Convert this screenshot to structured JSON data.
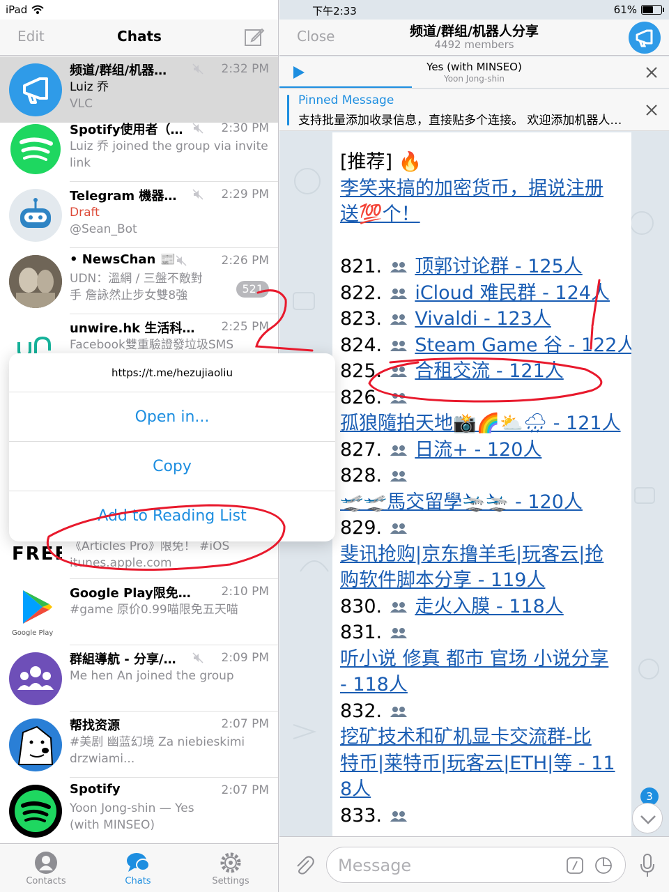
{
  "status_bar": {
    "device": "iPad",
    "time": "下午2:33",
    "battery": "61%",
    "battery_level": 0.61
  },
  "left_nav": {
    "edit_label": "Edit",
    "title": "Chats"
  },
  "chats": [
    {
      "name": "频道/群组/机器…",
      "time": "2:32 PM",
      "line1": "Luiz 乔",
      "line2": "VLC"
    },
    {
      "name": "Spotify使用者（…",
      "time": "2:30 PM",
      "line1": "Luiz 乔 joined the group via invite",
      "line2": "link"
    },
    {
      "name": "Telegram 機器…",
      "time": "2:29 PM",
      "line1": "Draft",
      "line2": "@Sean_Bot"
    },
    {
      "name": "• NewsChan 📰",
      "time": "2:26 PM",
      "line1": "UDN：溫網 / 三盤不敵對",
      "line2": "手 詹詠然止步女雙8強",
      "badge": "521"
    },
    {
      "name": "unwire.hk 生活科…",
      "time": "2:25 PM",
      "line1": "Facebook雙重驗證發垃圾SMS",
      "line2": ""
    },
    {
      "name": "",
      "time": "",
      "line1": "《Articles Pro》限免！ #iOS",
      "line2": "itunes.apple.com"
    },
    {
      "name": "Google Play限免…",
      "time": "2:10 PM",
      "line1": "#game 原价0.99喵限免五天喵",
      "line2": ""
    },
    {
      "name": "群組導航 - 分享/…",
      "time": "2:09 PM",
      "line1": "Me hen An joined the group",
      "line2": ""
    },
    {
      "name": "帮找资源",
      "time": "2:07 PM",
      "line1": "#美剧 幽蓝幻境 Za niebieskimi",
      "line2": "drzwiami..."
    },
    {
      "name": "Spotify",
      "time": "2:07 PM",
      "line1": "Yoon Jong-shin — Yes",
      "line2": "(with MINSEO)"
    }
  ],
  "avatar_text": {
    "freebie": "FREE",
    "google_play": "Google Play"
  },
  "tabs": [
    {
      "label": "Contacts",
      "icon": "person-icon"
    },
    {
      "label": "Chats",
      "icon": "chat-bubbles-icon"
    },
    {
      "label": "Settings",
      "icon": "gear-icon"
    }
  ],
  "popover": {
    "url": "https://t.me/hezujiaoliu",
    "items": [
      "Open in...",
      "Copy",
      "Add to Reading List"
    ]
  },
  "right_nav": {
    "close_label": "Close",
    "title": "频道/群组/机器人分享",
    "members": "4492 members"
  },
  "player": {
    "title": "Yes (with MINSEO)",
    "artist": "Yoon Jong-shin",
    "progress": 0.34
  },
  "pinned": {
    "label": "Pinned Message",
    "text": "支持批量添加收录信息，直接贴多个连接。 欢迎添加机器人…"
  },
  "message": {
    "heading": "[推荐] 🔥",
    "promo_line1": "李笑来搞的加密货币，据说注册",
    "promo_line2": "送💯个！",
    "entries": [
      {
        "num": "821.",
        "link": "顶郭讨论群 - 125人"
      },
      {
        "num": "822.",
        "link": "iCloud 难民群 - 124人"
      },
      {
        "num": "823.",
        "link": "Vivaldi - 123人"
      },
      {
        "num": "824.",
        "link": "Steam Game 谷 - 122人"
      },
      {
        "num": "825.",
        "link": "合租交流 - 121人"
      },
      {
        "num": "826.",
        "link": ""
      },
      {
        "num": "",
        "link": "孤狼隨拍天地📸🌈⛅🌧 - 121人"
      },
      {
        "num": "827.",
        "link": "日流+ - 120人"
      },
      {
        "num": "828.",
        "link": ""
      },
      {
        "num": "",
        "link": "🛫🛫馬交留學🛬🛬 - 120人"
      },
      {
        "num": "829.",
        "link": ""
      },
      {
        "num": "",
        "link": "斐讯抢购|京东撸羊毛|玩客云|抢"
      },
      {
        "num": "",
        "link": "购软件脚本分享 - 119人"
      },
      {
        "num": "830.",
        "link": "走火入膜 - 118人"
      },
      {
        "num": "831.",
        "link": ""
      },
      {
        "num": "",
        "link": "听小说 修真 都市 官场 小说分享"
      },
      {
        "num": "",
        "link": "- 118人"
      },
      {
        "num": "832.",
        "link": ""
      },
      {
        "num": "",
        "link": "挖矿技术和矿机显卡交流群-比"
      },
      {
        "num": "",
        "link": "特币|莱特币|玩客云|ETH|等 - 11"
      },
      {
        "num": "",
        "link": "8人"
      },
      {
        "num": "833.",
        "link": ""
      }
    ]
  },
  "scroll_badge": "3",
  "input": {
    "placeholder": "Message"
  },
  "colors": {
    "accent": "#1d8ee0",
    "link": "#1a5db3",
    "draft": "#dd4b39",
    "annotation": "#e8192c",
    "spotify": "#1ed760"
  }
}
